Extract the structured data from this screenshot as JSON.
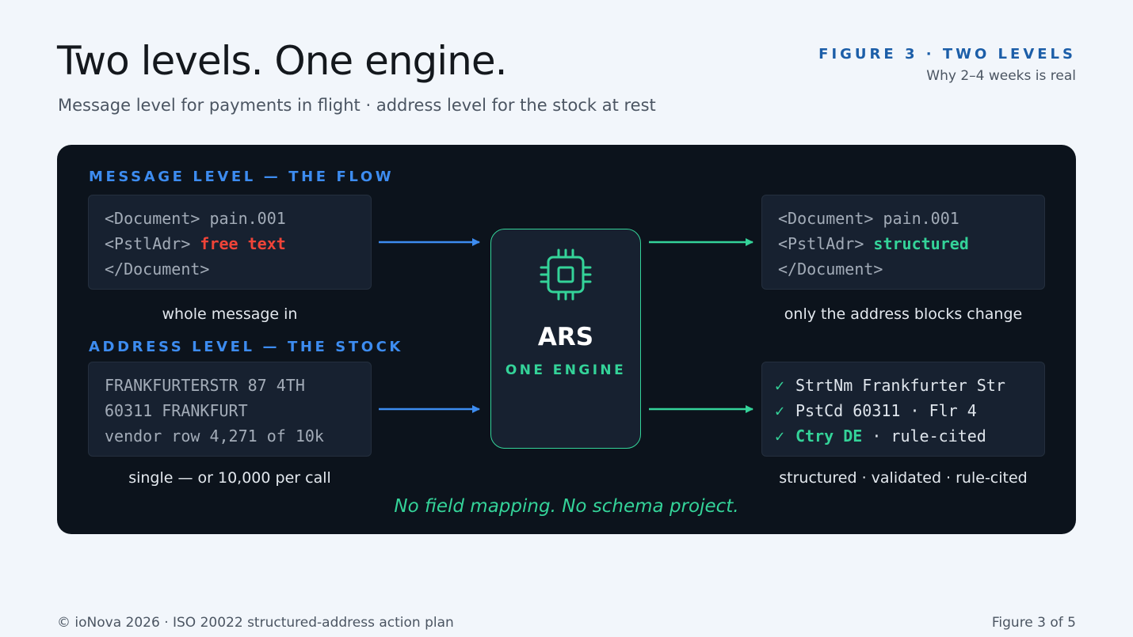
{
  "header": {
    "title": "Two levels. One engine.",
    "subtitle": "Message level for payments in flight · address level for the stock at rest",
    "figure_label": "FIGURE 3 · TWO LEVELS",
    "figure_sub": "Why 2–4 weeks is real"
  },
  "message_level": {
    "label": "MESSAGE LEVEL — THE FLOW",
    "input": {
      "line1": "<Document> pain.001",
      "line2_tag": "<PstlAdr> ",
      "line2_value": "free text",
      "line3": "</Document>"
    },
    "input_caption": "whole message in",
    "output": {
      "line1": "<Document> pain.001",
      "line2_tag": "<PstlAdr> ",
      "line2_value": "structured",
      "line3": "</Document>"
    },
    "output_caption": "only the address blocks change"
  },
  "address_level": {
    "label": "ADDRESS LEVEL — THE STOCK",
    "input": {
      "line1": "FRANKFURTERSTR 87 4TH",
      "line2": "60311 FRANKFURT",
      "line3": "vendor row 4,271 of 10k"
    },
    "input_caption": "single — or 10,000 per call",
    "output": {
      "check_icon": "✓",
      "line1": "StrtNm Frankfurter Str",
      "line2": "PstCd 60311 · Flr 4",
      "line3_value": "Ctry DE",
      "line3_rest": " · rule-cited"
    },
    "output_caption": "structured · validated · rule-cited"
  },
  "engine": {
    "name": "ARS",
    "tagline": "ONE ENGINE",
    "icon": "chip-icon"
  },
  "footnote": "No field mapping. No schema project.",
  "footer": {
    "left": "© ioNova 2026 · ISO 20022 structured-address action plan",
    "right": "Figure 3 of 5"
  },
  "colors": {
    "accent_blue": "#3d8cf0",
    "accent_green": "#34d399",
    "accent_red": "#f04438",
    "panel_bg": "#0c131c"
  }
}
